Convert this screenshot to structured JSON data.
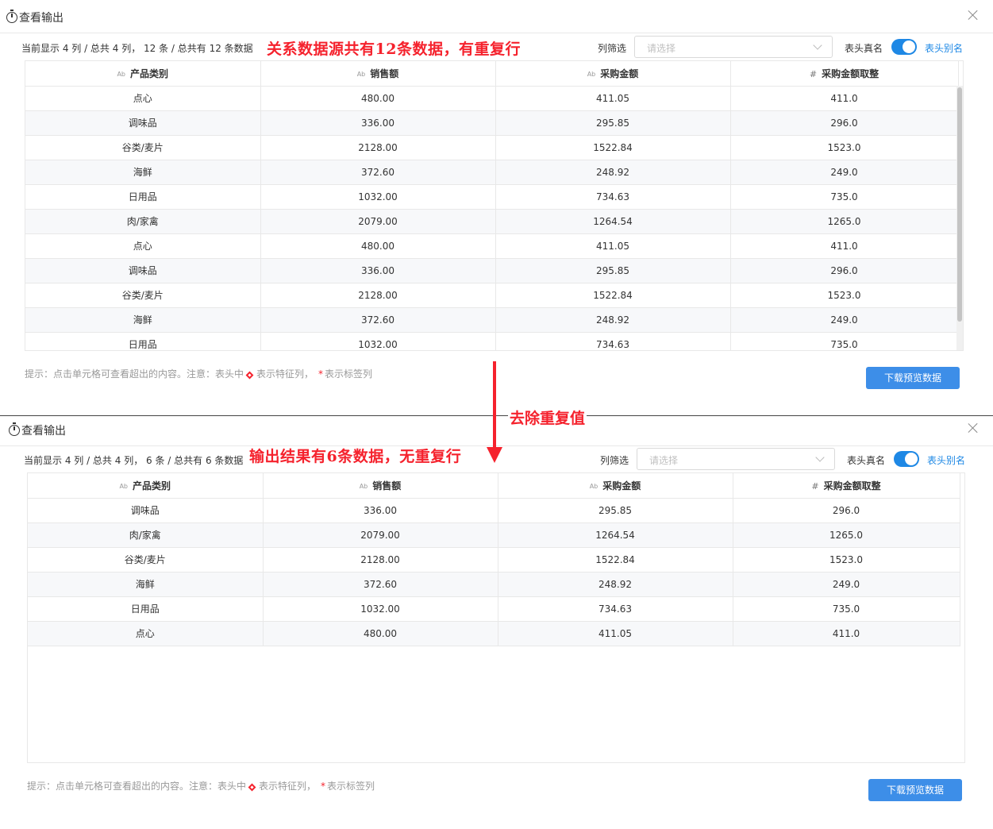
{
  "colors": {
    "accent": "#1e88e5",
    "annotation": "#f5222d",
    "button": "#3d8ee8"
  },
  "shared": {
    "dialog_title": "查看输出",
    "filter_label": "列筛选",
    "filter_placeholder": "请选择",
    "header_realname_label": "表头真名",
    "header_alias_link": "表头别名",
    "hint_prefix": "提示：点击单元格可查看超出的内容。注意：表头中",
    "hint_feature": "表示特征列，",
    "hint_star": "*",
    "hint_label": "表示标签列",
    "download_button": "下载预览数据",
    "columns": [
      {
        "label": "产品类别",
        "type_icon": "Ab"
      },
      {
        "label": "销售额",
        "type_icon": "Ab"
      },
      {
        "label": "采购金额",
        "type_icon": "Ab"
      },
      {
        "label": "采购金额取整",
        "type_icon": "#"
      }
    ]
  },
  "top": {
    "info": "当前显示 4 列 / 总共 4 列， 12 条 / 总共有 12 条数据",
    "annotation": "关系数据源共有12条数据，有重复行",
    "rows": [
      [
        "点心",
        "480.00",
        "411.05",
        "411.0"
      ],
      [
        "调味品",
        "336.00",
        "295.85",
        "296.0"
      ],
      [
        "谷类/麦片",
        "2128.00",
        "1522.84",
        "1523.0"
      ],
      [
        "海鲜",
        "372.60",
        "248.92",
        "249.0"
      ],
      [
        "日用品",
        "1032.00",
        "734.63",
        "735.0"
      ],
      [
        "肉/家禽",
        "2079.00",
        "1264.54",
        "1265.0"
      ],
      [
        "点心",
        "480.00",
        "411.05",
        "411.0"
      ],
      [
        "调味品",
        "336.00",
        "295.85",
        "296.0"
      ],
      [
        "谷类/麦片",
        "2128.00",
        "1522.84",
        "1523.0"
      ],
      [
        "海鲜",
        "372.60",
        "248.92",
        "249.0"
      ],
      [
        "日用品",
        "1032.00",
        "734.63",
        "735.0"
      ]
    ]
  },
  "middle": {
    "dedupe_label": "去除重复值"
  },
  "bottom": {
    "info": "当前显示 4 列 / 总共 4 列， 6 条 / 总共有 6 条数据",
    "annotation": "输出结果有6条数据，无重复行",
    "rows": [
      [
        "调味品",
        "336.00",
        "295.85",
        "296.0"
      ],
      [
        "肉/家禽",
        "2079.00",
        "1264.54",
        "1265.0"
      ],
      [
        "谷类/麦片",
        "2128.00",
        "1522.84",
        "1523.0"
      ],
      [
        "海鲜",
        "372.60",
        "248.92",
        "249.0"
      ],
      [
        "日用品",
        "1032.00",
        "734.63",
        "735.0"
      ],
      [
        "点心",
        "480.00",
        "411.05",
        "411.0"
      ]
    ]
  }
}
